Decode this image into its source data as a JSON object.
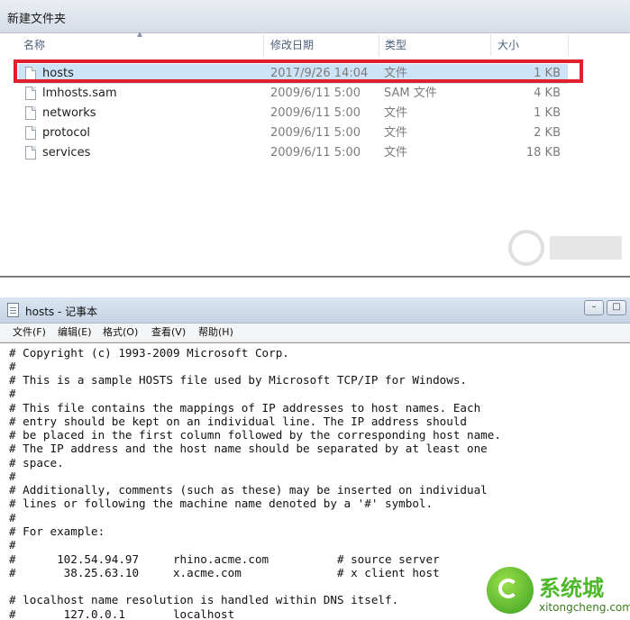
{
  "explorer": {
    "folder_title": "新建文件夹",
    "columns": {
      "name": "名称",
      "date": "修改日期",
      "type": "类型",
      "size": "大小"
    },
    "files": [
      {
        "name": "hosts",
        "date": "2017/9/26 14:04",
        "type": "文件",
        "size": "1 KB",
        "selected": true
      },
      {
        "name": "lmhosts.sam",
        "date": "2009/6/11 5:00",
        "type": "SAM 文件",
        "size": "4 KB"
      },
      {
        "name": "networks",
        "date": "2009/6/11 5:00",
        "type": "文件",
        "size": "1 KB"
      },
      {
        "name": "protocol",
        "date": "2009/6/11 5:00",
        "type": "文件",
        "size": "2 KB"
      },
      {
        "name": "services",
        "date": "2009/6/11 5:00",
        "type": "文件",
        "size": "18 KB"
      }
    ],
    "highlight_color": "#e0202a"
  },
  "notepad": {
    "title": "hosts - 记事本",
    "menu": [
      "文件(F)",
      "编辑(E)",
      "格式(O)",
      "查看(V)",
      "帮助(H)"
    ],
    "lines": [
      "# Copyright (c) 1993-2009 Microsoft Corp.",
      "#",
      "# This is a sample HOSTS file used by Microsoft TCP/IP for Windows.",
      "#",
      "# This file contains the mappings of IP addresses to host names. Each",
      "# entry should be kept on an individual line. The IP address should",
      "# be placed in the first column followed by the corresponding host name.",
      "# The IP address and the host name should be separated by at least one",
      "# space.",
      "#",
      "# Additionally, comments (such as these) may be inserted on individual",
      "# lines or following the machine name denoted by a '#' symbol.",
      "#",
      "# For example:",
      "#",
      "#      102.54.94.97     rhino.acme.com          # source server",
      "#       38.25.63.10     x.acme.com              # x client host",
      "",
      "# localhost name resolution is handled within DNS itself.",
      "#       127.0.0.1       localhost"
    ]
  },
  "watermark": {
    "text": "系统城",
    "url": "xitongcheng.com"
  },
  "colors": {
    "selection": "#cde3f7",
    "watermark_green": "#4fb82a"
  }
}
